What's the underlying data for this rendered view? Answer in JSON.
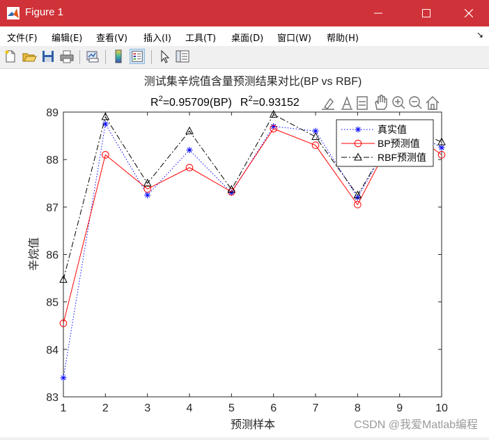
{
  "window": {
    "title": "Figure 1",
    "accent": "#cf3238"
  },
  "menu": [
    {
      "id": "file",
      "label": "文件(F)"
    },
    {
      "id": "edit",
      "label": "编辑(E)"
    },
    {
      "id": "view",
      "label": "查看(V)"
    },
    {
      "id": "insert",
      "label": "插入(I)"
    },
    {
      "id": "tools",
      "label": "工具(T)"
    },
    {
      "id": "desktop",
      "label": "桌面(D)"
    },
    {
      "id": "window",
      "label": "窗口(W)"
    },
    {
      "id": "help",
      "label": "帮助(H)"
    }
  ],
  "toolbar": [
    "new-figure-icon",
    "open-icon",
    "save-icon",
    "print-icon",
    "link-plot-icon",
    "colorbar-icon",
    "legend-icon",
    "pointer-icon",
    "property-inspector-icon"
  ],
  "axes_toolbar": [
    "brush-icon",
    "data-tip-icon",
    "rotate-icon",
    "pan-icon",
    "zoom-in-icon",
    "zoom-out-icon",
    "home-icon"
  ],
  "watermark": "CSDN @我爱Matlab编程",
  "chart_data": {
    "type": "line",
    "title": "测试集辛烷值含量预测结果对比(BP vs RBF)",
    "subtitle_visible": {
      "r2_bp": "R",
      "sup_bp": "2",
      "val_bp": "=0.95709(BP)",
      "r2_rbf": "R",
      "sup_rbf": "2",
      "val_rbf": "=0.93152"
    },
    "xlabel": "预测样本",
    "ylabel": "辛烷值",
    "x": [
      1,
      2,
      3,
      4,
      5,
      6,
      7,
      8,
      9,
      10
    ],
    "xlim": [
      1,
      10
    ],
    "ylim": [
      83,
      89
    ],
    "xticks": [
      "1",
      "2",
      "3",
      "4",
      "5",
      "6",
      "7",
      "8",
      "9",
      "10"
    ],
    "yticks": [
      "83",
      "84",
      "85",
      "86",
      "87",
      "88",
      "89"
    ],
    "grid": false,
    "legend_position": "top-right",
    "series": [
      {
        "name": "真实值",
        "color": "#0000ff",
        "line": "dotted",
        "marker": "star",
        "values": [
          83.4,
          88.75,
          87.25,
          88.2,
          87.3,
          88.7,
          88.6,
          87.2,
          88.75,
          88.25
        ]
      },
      {
        "name": "BP预测值",
        "color": "#ff0000",
        "line": "solid",
        "marker": "circle",
        "values": [
          84.55,
          88.1,
          87.38,
          87.83,
          87.32,
          88.65,
          88.3,
          87.05,
          88.75,
          88.1
        ]
      },
      {
        "name": "RBF预测值",
        "color": "#000000",
        "line": "dashdot",
        "marker": "triangle",
        "values": [
          85.47,
          88.9,
          87.5,
          88.6,
          87.37,
          88.95,
          88.48,
          87.25,
          88.75,
          88.37
        ]
      }
    ]
  }
}
